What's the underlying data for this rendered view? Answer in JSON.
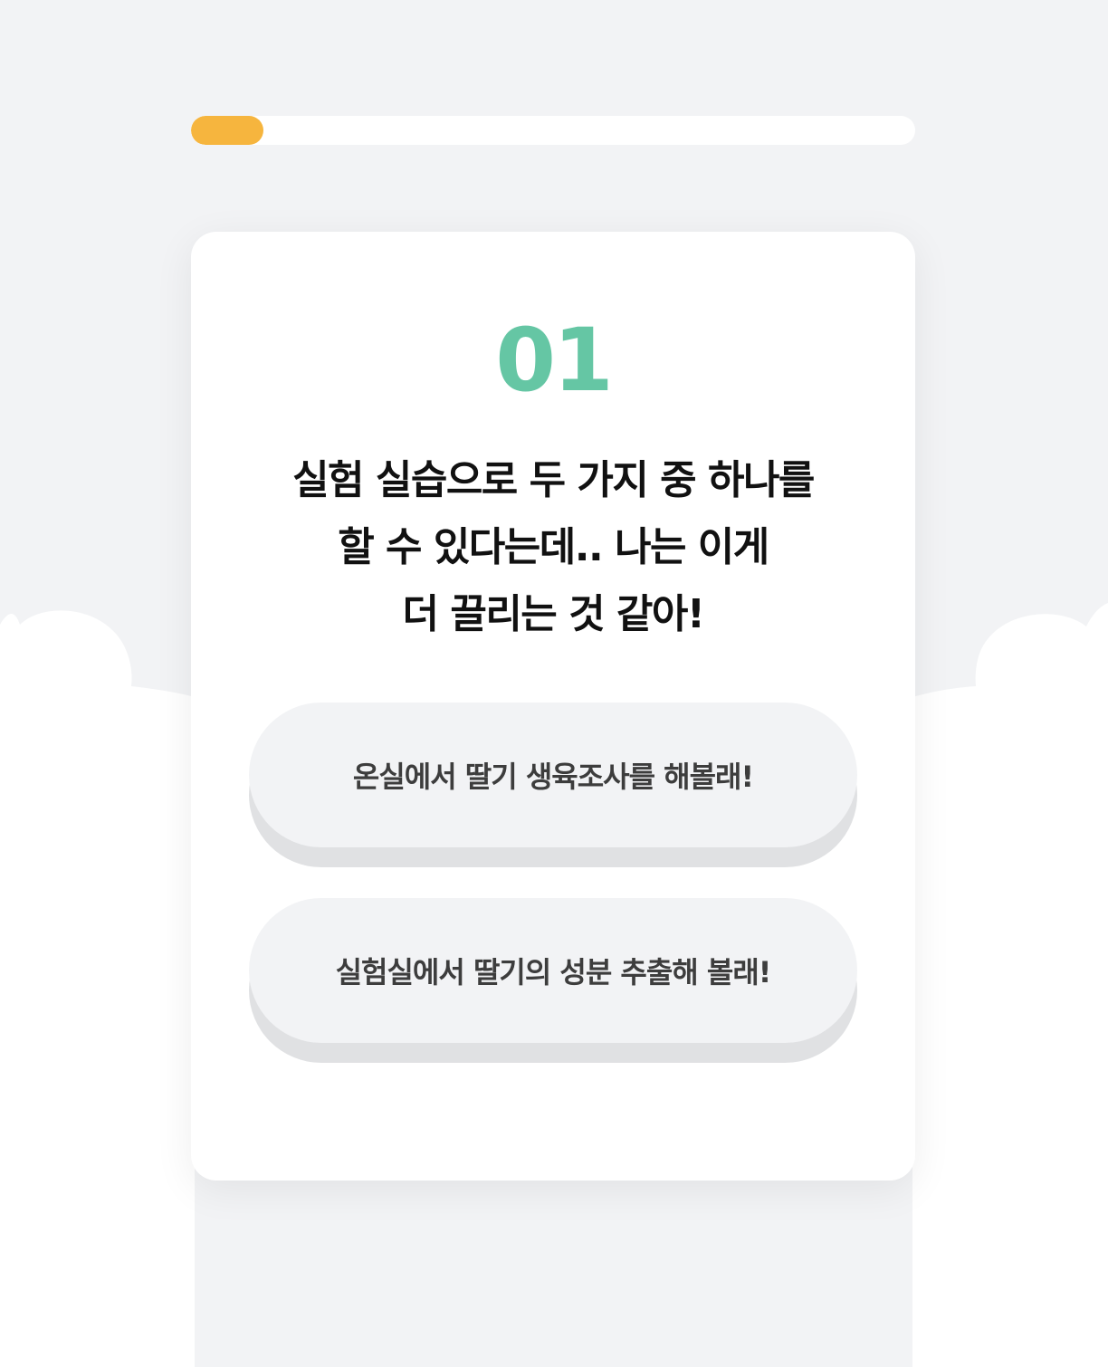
{
  "progress": {
    "value": 0.1,
    "color": "#f6b53e"
  },
  "theme": {
    "accent": "#65c6a4",
    "background": "#f2f3f5"
  },
  "question_card": {
    "step_number": "01",
    "question_lines": [
      "실험 실습으로 두 가지 중 하나를",
      "할 수 있다는데.. 나는 이게",
      "더 끌리는 것 같아!"
    ],
    "options": [
      {
        "label": "온실에서 딸기 생육조사를 해볼래!"
      },
      {
        "label": "실험실에서 딸기의 성분 추출해 볼래!"
      }
    ]
  }
}
